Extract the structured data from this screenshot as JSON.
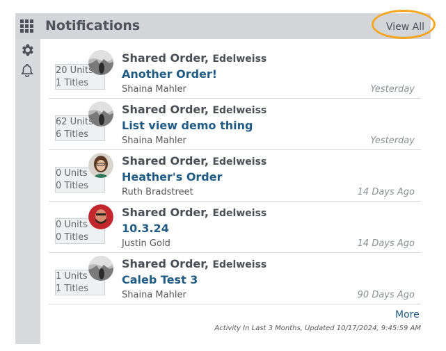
{
  "header": {
    "title": "Notifications",
    "view_all_label": "View All"
  },
  "notifications": [
    {
      "order_type": "Shared Order,",
      "vendor": "Edelweiss",
      "order_name": "Another Order!",
      "user": "Shaina Mahler",
      "time": "Yesterday",
      "units": "20 Units",
      "titles": "1 Titles",
      "avatar": "grayscale-photo-avatar"
    },
    {
      "order_type": "Shared Order,",
      "vendor": "Edelweiss",
      "order_name": "List view demo thing",
      "user": "Shaina Mahler",
      "time": "Yesterday",
      "units": "62 Units",
      "titles": "6 Titles",
      "avatar": "grayscale-photo-avatar"
    },
    {
      "order_type": "Shared Order,",
      "vendor": "Edelweiss",
      "order_name": "Heather's Order",
      "user": "Ruth Bradstreet",
      "time": "14 Days Ago",
      "units": "0 Units",
      "titles": "0 Titles",
      "avatar": "color-photo-avatar"
    },
    {
      "order_type": "Shared Order,",
      "vendor": "Edelweiss",
      "order_name": "10.3.24",
      "user": "Justin Gold",
      "time": "14 Days Ago",
      "units": "0 Units",
      "titles": "0 Titles",
      "avatar": "red-photo-avatar"
    },
    {
      "order_type": "Shared Order,",
      "vendor": "Edelweiss",
      "order_name": "Caleb Test 3",
      "user": "Shaina Mahler",
      "time": "90 Days Ago",
      "units": "1 Units",
      "titles": "1 Titles",
      "avatar": "grayscale-photo-avatar"
    }
  ],
  "footer": {
    "more_label": "More",
    "activity_text": "Activity In Last 3 Months, Updated 10/17/2024, 9:45:59 AM"
  },
  "colors": {
    "accent_link": "#1f5b83",
    "highlight_ring": "#f5a623",
    "header_bg": "#d3d5d8"
  },
  "icons": {
    "apps": "grid-icon",
    "settings": "gear-icon",
    "notifications": "bell-icon"
  }
}
